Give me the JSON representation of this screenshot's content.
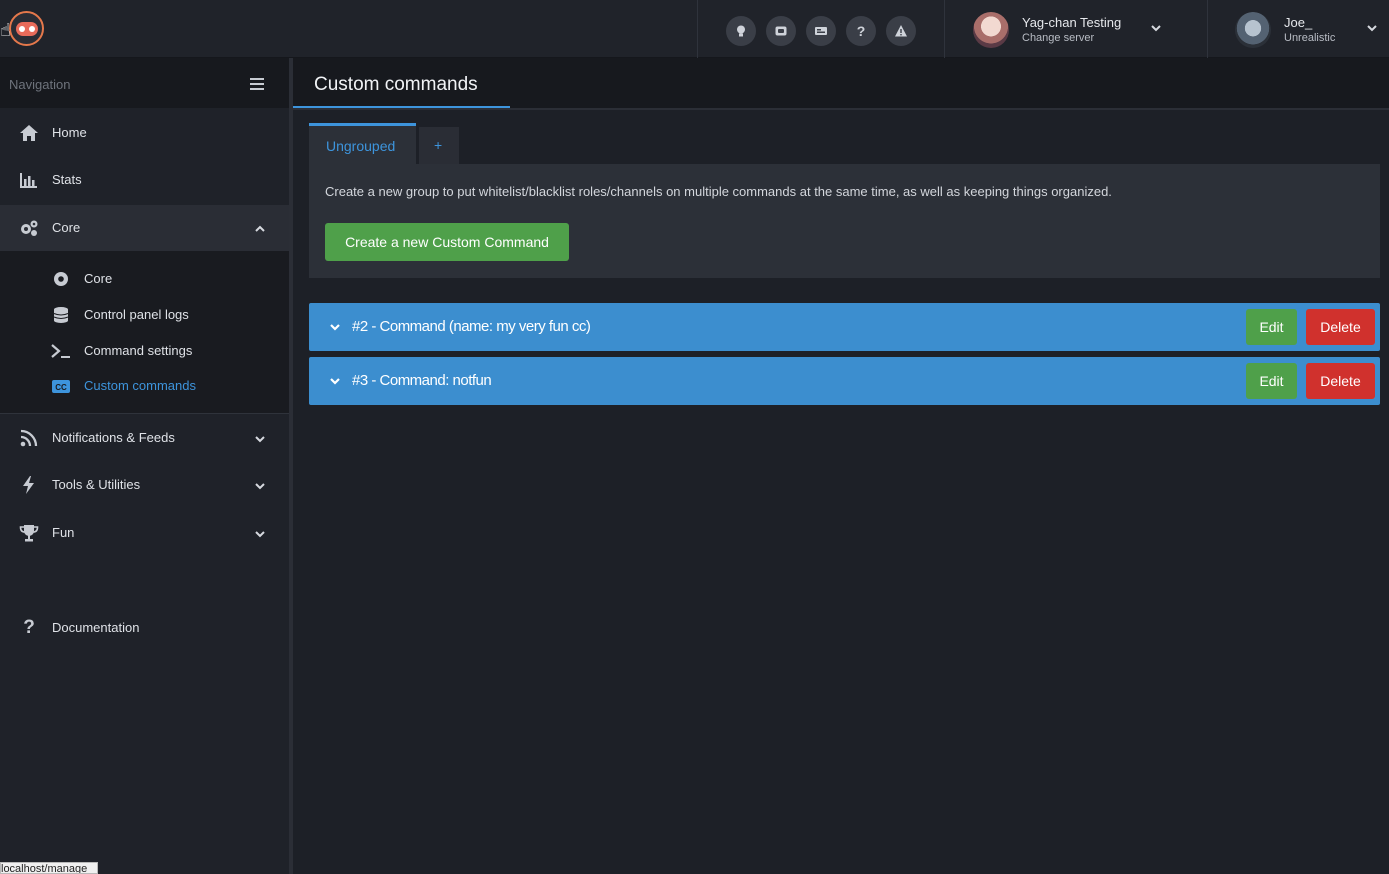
{
  "header": {
    "icons": [
      "lightbulb-icon",
      "discord-icon",
      "news-icon",
      "help-icon",
      "warning-icon"
    ],
    "server": {
      "name": "Yag-chan Testing",
      "sub": "Change server"
    },
    "user": {
      "name": "Joe_",
      "sub": "Unrealistic"
    }
  },
  "sidebar": {
    "heading": "Navigation",
    "items": [
      {
        "label": "Home"
      },
      {
        "label": "Stats"
      },
      {
        "label": "Core"
      },
      {
        "label": "Notifications & Feeds"
      },
      {
        "label": "Tools & Utilities"
      },
      {
        "label": "Fun"
      },
      {
        "label": "Documentation"
      }
    ],
    "core_sub": [
      {
        "label": "Core"
      },
      {
        "label": "Control panel logs"
      },
      {
        "label": "Command settings"
      },
      {
        "label": "Custom commands"
      }
    ]
  },
  "page": {
    "title": "Custom commands",
    "tabs": [
      {
        "label": "Ungrouped"
      },
      {
        "label": "+"
      }
    ],
    "description": "Create a new group to put whitelist/blacklist roles/channels on multiple commands at the same time, as well as keeping things organized.",
    "create_button": "Create a new Custom Command",
    "commands": [
      {
        "label": "#2 - Command (name: my very fun cc)",
        "edit": "Edit",
        "delete": "Delete"
      },
      {
        "label": "#3 - Command: notfun",
        "edit": "Edit",
        "delete": "Delete"
      }
    ]
  },
  "status_bar": {
    "url": "localhost/manage"
  },
  "colors": {
    "accent": "#3d94dc",
    "success": "#4fa04a",
    "danger": "#d0312d",
    "row": "#3c8ecf"
  }
}
